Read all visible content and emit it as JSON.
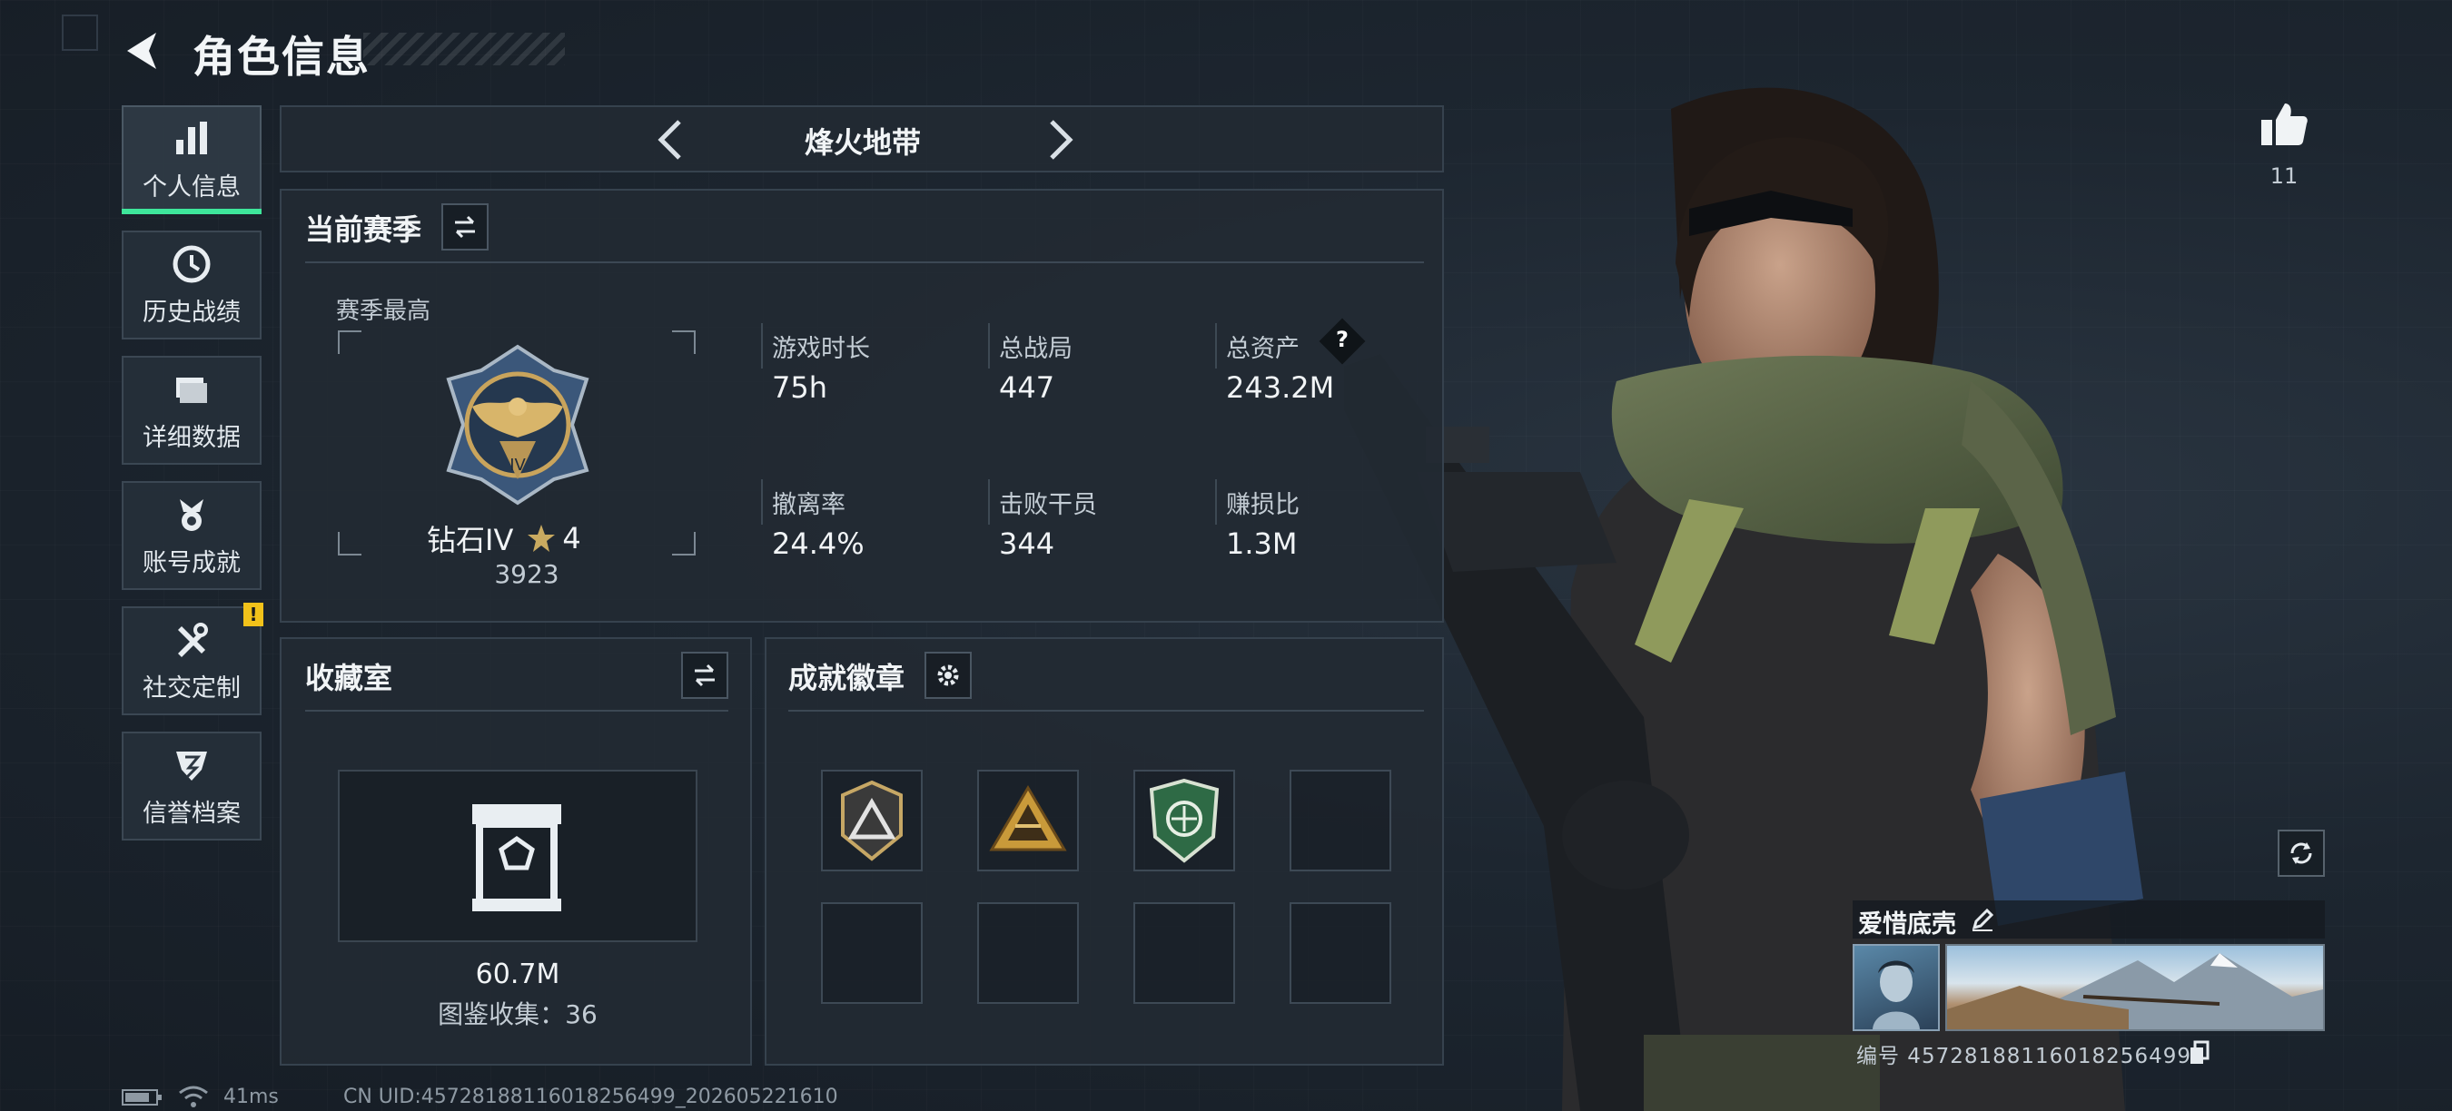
{
  "header": {
    "title": "角色信息"
  },
  "sidebar": {
    "items": [
      {
        "label": "个人信息",
        "icon": "bar-chart-icon",
        "active": true
      },
      {
        "label": "历史战绩",
        "icon": "clock-icon"
      },
      {
        "label": "详细数据",
        "icon": "folder-icon"
      },
      {
        "label": "账号成就",
        "icon": "medal-icon"
      },
      {
        "label": "社交定制",
        "icon": "tools-icon",
        "badge": "!"
      },
      {
        "label": "信誉档案",
        "icon": "shield-icon"
      }
    ]
  },
  "mode_selector": {
    "title": "烽火地带"
  },
  "season": {
    "title": "当前赛季",
    "best_label": "赛季最高",
    "rank_name": "钻石IV",
    "rank_stars": "4",
    "rank_score": "3923",
    "stats": [
      {
        "label": "游戏时长",
        "value": "75h"
      },
      {
        "label": "总战局",
        "value": "447"
      },
      {
        "label": "总资产",
        "value": "243.2M",
        "help": "?"
      },
      {
        "label": "撤离率",
        "value": "24.4%"
      },
      {
        "label": "击败干员",
        "value": "344"
      },
      {
        "label": "赚损比",
        "value": "1.3M"
      }
    ]
  },
  "collection": {
    "title": "收藏室",
    "value": "60.7M",
    "catalog_label": "图鉴收集：36"
  },
  "achievements": {
    "title": "成就徽章",
    "slots_filled": [
      "badge-triangle",
      "badge-pyramid",
      "badge-shield-green"
    ],
    "slot_count": 8
  },
  "right": {
    "likes": "11",
    "player_name": "爱惜底壳",
    "player_id": "编号 4572818811601825649​9"
  },
  "footer": {
    "ping": "41ms",
    "uid": "CN UID:4572818811601825649​9_202605221610"
  },
  "colors": {
    "accent": "#3ee69b",
    "warn": "#f2c21a",
    "panel": "#222a33"
  }
}
